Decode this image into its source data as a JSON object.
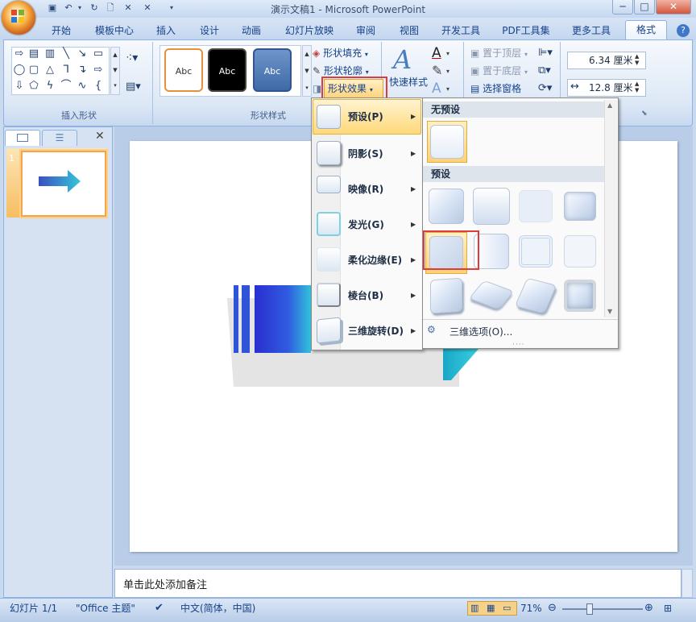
{
  "window": {
    "title": "演示文稿1 - Microsoft PowerPoint",
    "minimize": "─",
    "restore": "□",
    "close": "✕"
  },
  "tabs": [
    {
      "label": "开始"
    },
    {
      "label": "模板中心"
    },
    {
      "label": "插入"
    },
    {
      "label": "设计"
    },
    {
      "label": "动画"
    },
    {
      "label": "幻灯片放映"
    },
    {
      "label": "审阅"
    },
    {
      "label": "视图"
    },
    {
      "label": "开发工具"
    },
    {
      "label": "PDF工具集"
    },
    {
      "label": "更多工具"
    },
    {
      "label": "格式"
    }
  ],
  "ribbon": {
    "groups": {
      "insert_shapes": "插入形状",
      "shape_styles": "形状样式"
    },
    "abc_label": "Abc",
    "shape_fill": "形状填充",
    "shape_outline": "形状轮廓",
    "shape_effects": "形状效果",
    "quick_styles": "快速样式",
    "bring_front": "置于顶层",
    "send_back": "置于底层",
    "selection_pane": "选择窗格",
    "height_value": "6.34 厘米",
    "width_value": "12.8 厘米"
  },
  "effects_menu": {
    "items": [
      {
        "label": "预设(P)"
      },
      {
        "label": "阴影(S)"
      },
      {
        "label": "映像(R)"
      },
      {
        "label": "发光(G)"
      },
      {
        "label": "柔化边缘(E)"
      },
      {
        "label": "棱台(B)"
      },
      {
        "label": "三维旋转(D)"
      }
    ]
  },
  "preset_menu": {
    "no_preset": "无预设",
    "preset": "预设",
    "options_3d": "三维选项(O)..."
  },
  "left_pane": {
    "slide_number": "1"
  },
  "notes": {
    "placeholder": "单击此处添加备注"
  },
  "status": {
    "slide": "幻灯片 1/1",
    "theme": "\"Office 主题\"",
    "language": "中文(简体，中国)",
    "zoom": "71%"
  },
  "colors": {
    "accent": "#15428b",
    "highlight": "#ffd87a",
    "red_box": "#e03b3b"
  }
}
